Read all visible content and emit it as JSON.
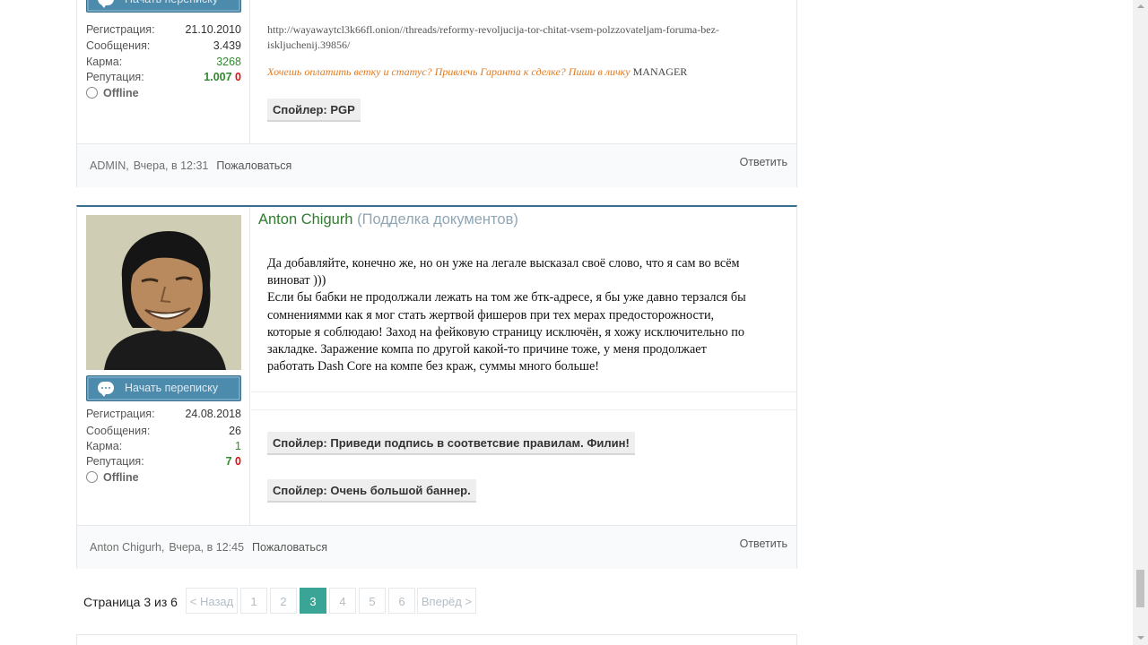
{
  "post1": {
    "msg_button": "Начать переписку",
    "stats": [
      {
        "label": "Регистрация:",
        "value": "21.10.2010"
      },
      {
        "label": "Сообщения:",
        "value": "3.439"
      },
      {
        "label": "Карма:",
        "value": "3268"
      }
    ],
    "rep_label": "Репутация:",
    "rep_pos": "1.007",
    "rep_neg": "0",
    "status": "Offline",
    "url_line1": "http://wayawaytcl3k66fl.onion//threads/reformy-revoljucija-tor-chitat-vsem-polzzovateljam-foruma-bez-",
    "url_line2": "iskljuchenij.39856/",
    "ad_text": "Хочешь оплатить ветку и статус? Привлечь Гаранта к сделке? Пиши в личку",
    "ad_manager": "MANAGER",
    "spoiler": "Спойлер: PGP",
    "footer_author": "ADMIN,",
    "footer_time": "Вчера, в 12:31",
    "footer_report": "Пожаловаться",
    "footer_reply": "Ответить"
  },
  "post2": {
    "username": "Anton Chigurh",
    "usertitle": "(Подделка документов)",
    "msg_button": "Начать переписку",
    "stats": [
      {
        "label": "Регистрация:",
        "value": "24.08.2018"
      },
      {
        "label": "Сообщения:",
        "value": "26"
      },
      {
        "label": "Карма:",
        "value": "1"
      }
    ],
    "rep_label": "Репутация:",
    "rep_pos": "7",
    "rep_neg": "0",
    "status": "Offline",
    "body_lines": [
      "Да добавляйте, конечно же, но он уже на легале высказал своё слово, что я сам во всём",
      "виноват )))",
      "Если бы бабки не продолжали лежать на том же бтк-адресе, я бы уже давно терзался бы",
      "сомнениямми как я мог стать жертвой фишеров при тех мерах предосторожности,",
      "которые я соблюдаю! Заход на фейковую страницу исключён, я хожу исключительно по",
      "закладке. Заражение компа по другой какой-то причине тоже, у меня продолжает",
      "работать Dash Core на компе без краж, суммы много больше!"
    ],
    "spoiler1": "Спойлер: Приведи подпись в соответсвие правилам. Филин!",
    "spoiler2": "Спойлер: Очень большой баннер.",
    "footer_author": "Anton Chigurh,",
    "footer_time": "Вчера, в 12:45",
    "footer_report": "Пожаловаться",
    "footer_reply": "Ответить"
  },
  "pagination": {
    "label": "Страница 3 из 6",
    "prev": "< Назад",
    "pages": [
      "1",
      "2",
      "3",
      "4",
      "5",
      "6"
    ],
    "current": "3",
    "next": "Вперёд >"
  },
  "colors": {
    "accent": "#3aa497",
    "button": "#4d8bac",
    "username": "#2f7d2f",
    "ad": "#e07a1f"
  }
}
